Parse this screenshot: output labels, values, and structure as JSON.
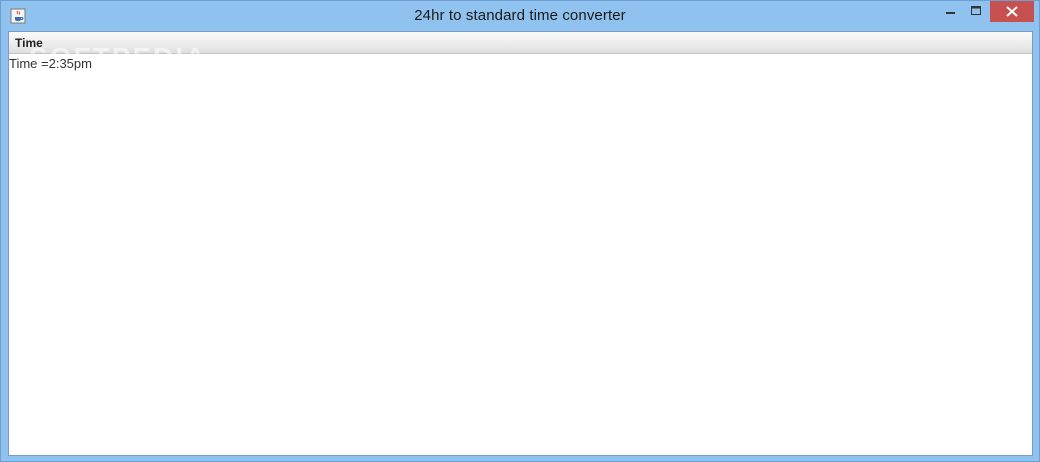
{
  "window": {
    "title": "24hr  to standard time converter",
    "controls": {
      "minimize_icon": "minimize-icon",
      "maximize_icon": "maximize-icon",
      "close_icon": "close-icon"
    },
    "app_icon": "java-cup-icon"
  },
  "table": {
    "columns": [
      "Time"
    ],
    "rows": [
      [
        "Time =2:35pm"
      ]
    ]
  },
  "watermark": "SOFTPEDIA",
  "colors": {
    "frame": "#8fc2ee",
    "close_button": "#c75050",
    "header_bg": "#e9e9e9"
  }
}
